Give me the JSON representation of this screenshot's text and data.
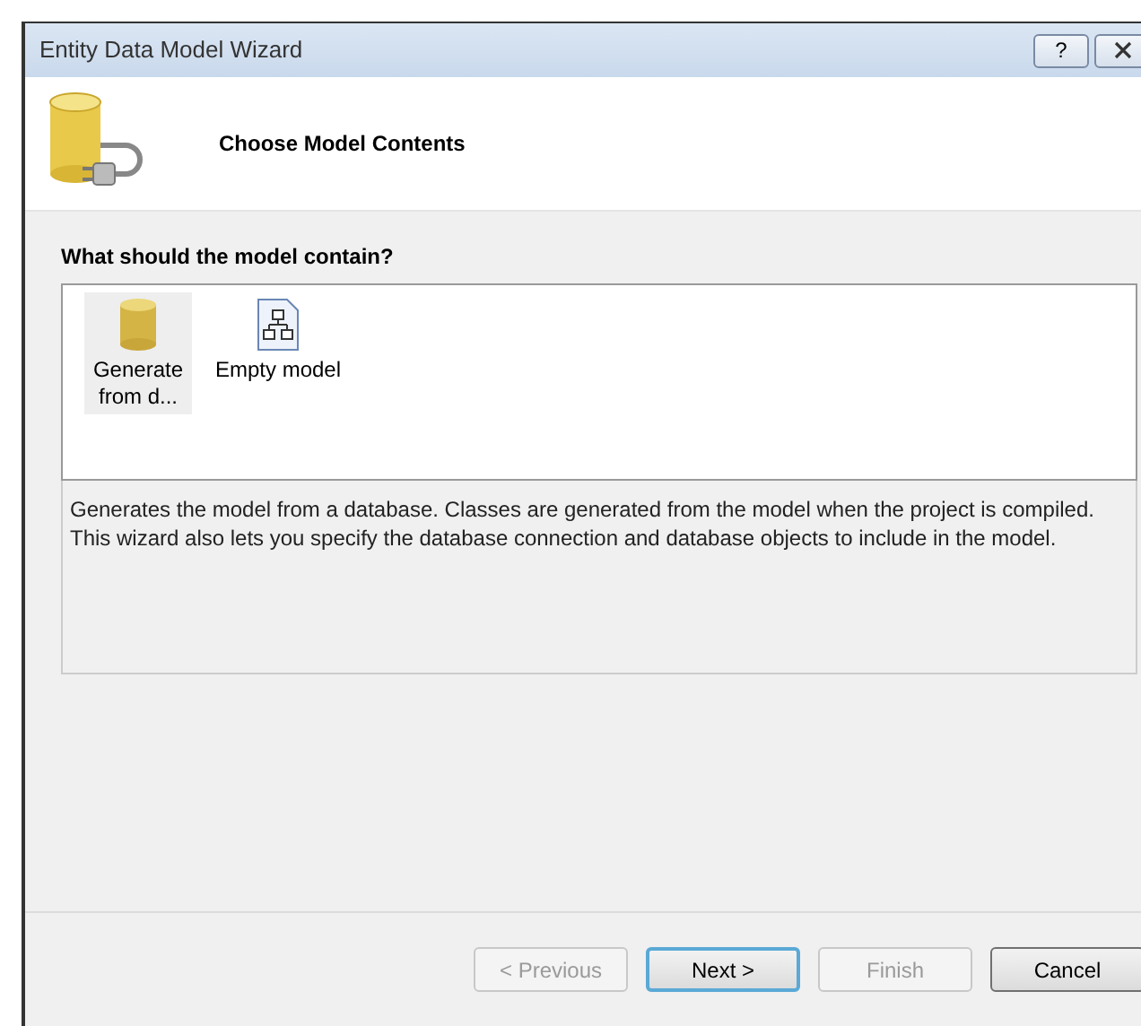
{
  "window": {
    "title": "Entity Data Model Wizard",
    "help_button": "?"
  },
  "header": {
    "title": "Choose Model Contents"
  },
  "question": "What should the model contain?",
  "options": [
    {
      "kind": "database",
      "label": "Generate from d...",
      "selected": true
    },
    {
      "kind": "empty",
      "label": "Empty model",
      "selected": false
    }
  ],
  "description": "Generates the model from a database. Classes are generated from the model when the project is compiled. This wizard also lets you specify the database connection and database objects to include in the model.",
  "buttons": [
    {
      "label": "< Previous",
      "disabled": true,
      "default": false
    },
    {
      "label": "Next >",
      "disabled": false,
      "default": true
    },
    {
      "label": "Finish",
      "disabled": true,
      "default": false
    },
    {
      "label": "Cancel",
      "disabled": false,
      "default": false
    }
  ]
}
